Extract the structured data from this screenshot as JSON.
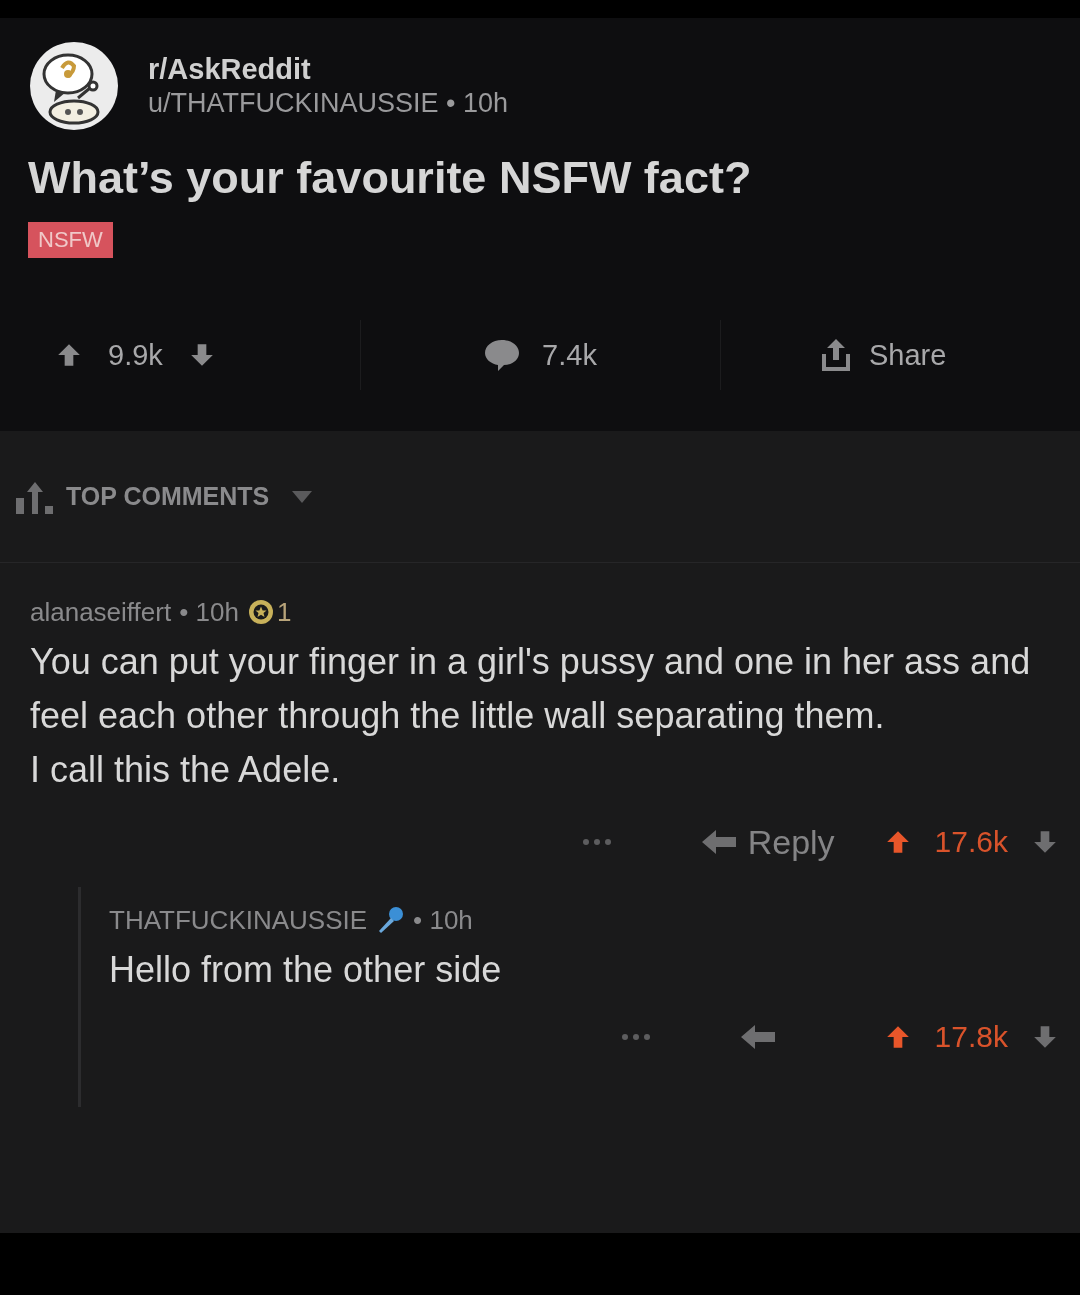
{
  "post": {
    "subreddit": "r/AskReddit",
    "author": "u/THATFUCKINAUSSIE",
    "age": "• 10h",
    "title": "What’s your favourite NSFW fact?",
    "tag": "NSFW",
    "votes": "9.9k",
    "comments": "7.4k",
    "share": "Share"
  },
  "sort": {
    "label": "TOP COMMENTS"
  },
  "comments": [
    {
      "author": "alanaseiffert",
      "age": "• 10h",
      "award_count": "1",
      "body": "You can put your finger in a girl's pussy and one in her ass and feel each other through the little wall separating them.\nI call this the Adele.",
      "reply": "Reply",
      "votes": "17.6k",
      "upvoted": true,
      "children": [
        {
          "author": "THATFUCKINAUSSIE",
          "age": "• 10h",
          "flair": true,
          "body": "Hello from the other side",
          "votes": "17.8k",
          "upvoted": true
        }
      ]
    }
  ]
}
